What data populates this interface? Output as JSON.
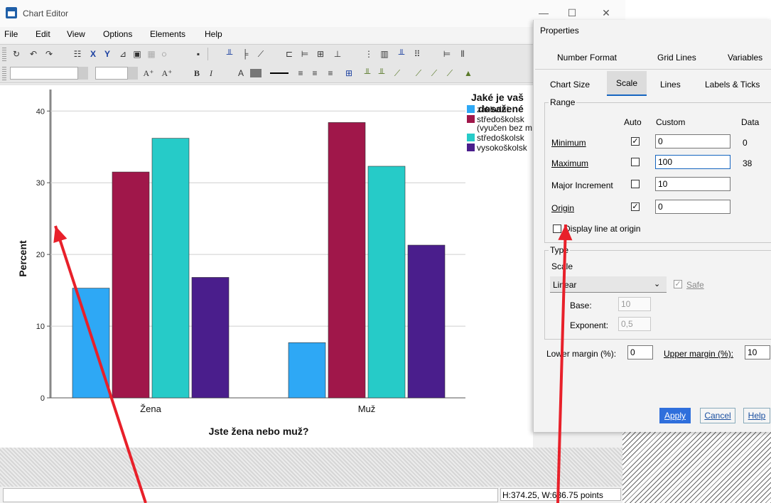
{
  "window": {
    "title": "Chart Editor",
    "controls": [
      "—",
      "☐",
      "✕"
    ]
  },
  "menus": [
    "File",
    "Edit",
    "View",
    "Options",
    "Elements",
    "Help"
  ],
  "chart_data": {
    "type": "bar",
    "categories": [
      "Žena",
      "Muž"
    ],
    "series": [
      {
        "name": "základní",
        "color": "#2ea8f5",
        "values": [
          15.3,
          7.7
        ]
      },
      {
        "name": "středoškolské (vyučen bez maturity)",
        "legend_lines": [
          "středoškolsk",
          "(vyučen bez m"
        ],
        "color": "#a0174a",
        "values": [
          31.5,
          38.4
        ]
      },
      {
        "name": "středoškolské",
        "legend_lines": [
          "středoškolsk"
        ],
        "color": "#26cbc8",
        "values": [
          36.2,
          32.3
        ]
      },
      {
        "name": "vysokoškolské",
        "legend_lines": [
          "vysokoškolsk"
        ],
        "color": "#4a1e8c",
        "values": [
          16.8,
          21.3
        ]
      }
    ],
    "legend_title_lines": [
      "Jaké je vaš",
      "dosažené"
    ],
    "xlabel": "Jste žena nebo muž?",
    "ylabel": "Percent",
    "ylim": [
      0,
      43
    ],
    "yticks": [
      0,
      10,
      20,
      30,
      40
    ],
    "grid": true
  },
  "status": {
    "size_text": "H:374.25, W:636.75 points"
  },
  "dialog": {
    "title": "Properties",
    "tabs_row1": [
      "Number Format",
      "Grid Lines",
      "Variables"
    ],
    "tabs_row2": [
      "Chart Size",
      "Scale",
      "Lines",
      "Labels & Ticks"
    ],
    "active_tab": "Scale",
    "range": {
      "label": "Range",
      "col_auto": "Auto",
      "col_custom": "Custom",
      "col_data": "Data",
      "rows": [
        {
          "label": "Minimum",
          "auto": true,
          "custom": "0",
          "data": "0"
        },
        {
          "label": "Maximum",
          "auto": false,
          "custom": "100",
          "data": "38"
        },
        {
          "label": "Major Increment",
          "auto": false,
          "custom": "10",
          "data": ""
        },
        {
          "label": "Origin",
          "auto": true,
          "custom": "0",
          "data": ""
        }
      ],
      "display_line": "Display line at origin"
    },
    "type": {
      "label": "Type",
      "scale_label": "Scale",
      "scale_value": "Linear",
      "safe_label": "Safe",
      "base_label": "Base:",
      "base_value": "10",
      "exponent_label": "Exponent:",
      "exponent_value": "0,5"
    },
    "lower_margin_label": "Lower margin (%):",
    "lower_margin_value": "0",
    "upper_margin_label": "Upper margin (%):",
    "upper_margin_value": "10",
    "buttons": {
      "apply": "Apply",
      "cancel": "Cancel",
      "help": "Help"
    }
  },
  "annotation_color": "#e8202a"
}
